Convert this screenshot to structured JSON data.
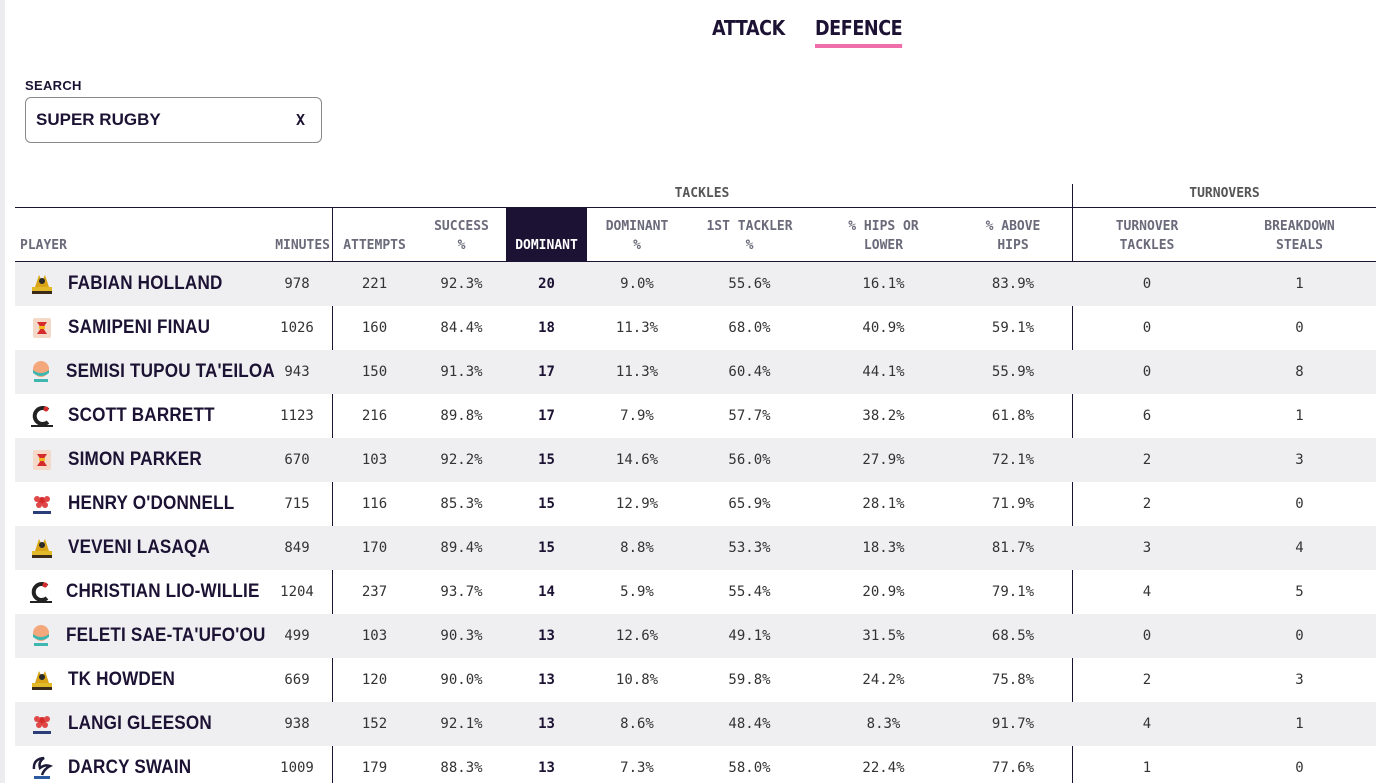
{
  "tabs": [
    {
      "label": "ATTACK",
      "active": false
    },
    {
      "label": "DEFENCE",
      "active": true
    }
  ],
  "search": {
    "label": "SEARCH",
    "value": "SUPER RUGBY",
    "clear_label": "X"
  },
  "groups": {
    "tackles": "TACKLES",
    "turnovers": "TURNOVERS"
  },
  "columns": {
    "player": "PLAYER",
    "minutes": "MINUTES",
    "attempts": "ATTEMPTS",
    "success_1": "SUCCESS",
    "success_2": "%",
    "dominant": "DOMINANT",
    "dominant_pct_1": "DOMINANT",
    "dominant_pct_2": "%",
    "first_tackler_1": "1ST TACKLER",
    "first_tackler_2": "%",
    "hips_lower_1": "% HIPS OR",
    "hips_lower_2": "LOWER",
    "above_hips_1": "% ABOVE",
    "above_hips_2": "HIPS",
    "turnover_tackles_1": "TURNOVER",
    "turnover_tackles_2": "TACKLES",
    "breakdown_steals_1": "BREAKDOWN",
    "breakdown_steals_2": "STEALS"
  },
  "colors": {
    "accent": "#f06fab",
    "ink": "#1c1233",
    "stripe": "#efeff1"
  },
  "rows": [
    {
      "name": "FABIAN HOLLAND",
      "team_icon": "highlanders-logo",
      "minutes": "978",
      "attempts": "221",
      "success": "92.3%",
      "dominant": "20",
      "dominant_pct": "9.0%",
      "first_tackler": "55.6%",
      "hips_lower": "16.1%",
      "above_hips": "83.9%",
      "turnover_tackles": "0",
      "breakdown_steals": "1"
    },
    {
      "name": "SAMIPENI FINAU",
      "team_icon": "chiefs-logo",
      "minutes": "1026",
      "attempts": "160",
      "success": "84.4%",
      "dominant": "18",
      "dominant_pct": "11.3%",
      "first_tackler": "68.0%",
      "hips_lower": "40.9%",
      "above_hips": "59.1%",
      "turnover_tackles": "0",
      "breakdown_steals": "0"
    },
    {
      "name": "SEMISI TUPOU TA'EILOA",
      "team_icon": "moana-pasifika-logo",
      "minutes": "943",
      "attempts": "150",
      "success": "91.3%",
      "dominant": "17",
      "dominant_pct": "11.3%",
      "first_tackler": "60.4%",
      "hips_lower": "44.1%",
      "above_hips": "55.9%",
      "turnover_tackles": "0",
      "breakdown_steals": "8"
    },
    {
      "name": "SCOTT BARRETT",
      "team_icon": "crusaders-logo",
      "minutes": "1123",
      "attempts": "216",
      "success": "89.8%",
      "dominant": "17",
      "dominant_pct": "7.9%",
      "first_tackler": "57.7%",
      "hips_lower": "38.2%",
      "above_hips": "61.8%",
      "turnover_tackles": "6",
      "breakdown_steals": "1"
    },
    {
      "name": "SIMON PARKER",
      "team_icon": "chiefs-logo",
      "minutes": "670",
      "attempts": "103",
      "success": "92.2%",
      "dominant": "15",
      "dominant_pct": "14.6%",
      "first_tackler": "56.0%",
      "hips_lower": "27.9%",
      "above_hips": "72.1%",
      "turnover_tackles": "2",
      "breakdown_steals": "3"
    },
    {
      "name": "HENRY O'DONNELL",
      "team_icon": "waratahs-logo",
      "minutes": "715",
      "attempts": "116",
      "success": "85.3%",
      "dominant": "15",
      "dominant_pct": "12.9%",
      "first_tackler": "65.9%",
      "hips_lower": "28.1%",
      "above_hips": "71.9%",
      "turnover_tackles": "2",
      "breakdown_steals": "0"
    },
    {
      "name": "VEVENI LASAQA",
      "team_icon": "highlanders-logo",
      "minutes": "849",
      "attempts": "170",
      "success": "89.4%",
      "dominant": "15",
      "dominant_pct": "8.8%",
      "first_tackler": "53.3%",
      "hips_lower": "18.3%",
      "above_hips": "81.7%",
      "turnover_tackles": "3",
      "breakdown_steals": "4"
    },
    {
      "name": "CHRISTIAN LIO-WILLIE",
      "team_icon": "crusaders-logo",
      "minutes": "1204",
      "attempts": "237",
      "success": "93.7%",
      "dominant": "14",
      "dominant_pct": "5.9%",
      "first_tackler": "55.4%",
      "hips_lower": "20.9%",
      "above_hips": "79.1%",
      "turnover_tackles": "4",
      "breakdown_steals": "5"
    },
    {
      "name": "FELETI SAE-TA'UFO'OU",
      "team_icon": "moana-pasifika-logo",
      "minutes": "499",
      "attempts": "103",
      "success": "90.3%",
      "dominant": "13",
      "dominant_pct": "12.6%",
      "first_tackler": "49.1%",
      "hips_lower": "31.5%",
      "above_hips": "68.5%",
      "turnover_tackles": "0",
      "breakdown_steals": "0"
    },
    {
      "name": "TK HOWDEN",
      "team_icon": "highlanders-logo",
      "minutes": "669",
      "attempts": "120",
      "success": "90.0%",
      "dominant": "13",
      "dominant_pct": "10.8%",
      "first_tackler": "59.8%",
      "hips_lower": "24.2%",
      "above_hips": "75.8%",
      "turnover_tackles": "2",
      "breakdown_steals": "3"
    },
    {
      "name": "LANGI GLEESON",
      "team_icon": "waratahs-logo",
      "minutes": "938",
      "attempts": "152",
      "success": "92.1%",
      "dominant": "13",
      "dominant_pct": "8.6%",
      "first_tackler": "48.4%",
      "hips_lower": "8.3%",
      "above_hips": "91.7%",
      "turnover_tackles": "4",
      "breakdown_steals": "1"
    },
    {
      "name": "DARCY SWAIN",
      "team_icon": "western-force-logo",
      "minutes": "1009",
      "attempts": "179",
      "success": "88.3%",
      "dominant": "13",
      "dominant_pct": "7.3%",
      "first_tackler": "58.0%",
      "hips_lower": "22.4%",
      "above_hips": "77.6%",
      "turnover_tackles": "1",
      "breakdown_steals": "0"
    }
  ]
}
